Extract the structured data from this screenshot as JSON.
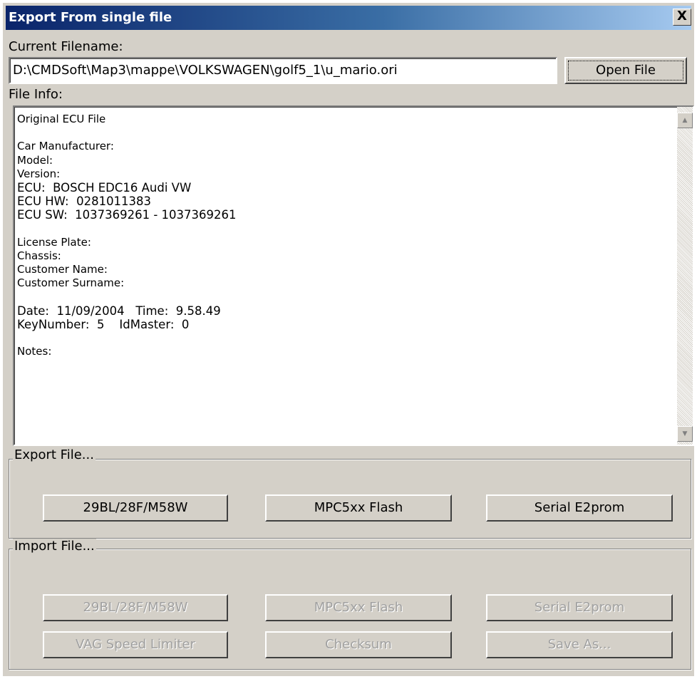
{
  "window": {
    "title": "Export From single file",
    "close_glyph": "X"
  },
  "current_filename": {
    "label": "Current Filename:",
    "value": "D:\\CMDSoft\\Map3\\mappe\\VOLKSWAGEN\\golf5_1\\u_mario.ori",
    "open_button": "Open File"
  },
  "file_info": {
    "label": "File Info:",
    "lines": [
      "Original ECU File",
      "",
      "Car Manufacturer:",
      "Model:",
      "Version:",
      "ECU:  BOSCH EDC16 Audi VW",
      "ECU HW:  0281011383",
      "ECU SW:  1037369261 - 1037369261",
      "",
      "License Plate:",
      "Chassis:",
      "Customer Name:",
      "Customer Surname:",
      "",
      "Date:  11/09/2004   Time:  9.58.49",
      "KeyNumber:  5    IdMaster:  0",
      "",
      "Notes:"
    ],
    "scroll_up_icon": "arrow-up-icon",
    "scroll_down_icon": "arrow-down-icon"
  },
  "export_group": {
    "title": "Export File...",
    "buttons": [
      "29BL/28F/M58W",
      "MPC5xx Flash",
      "Serial E2prom"
    ]
  },
  "import_group": {
    "title": "Import File...",
    "buttons_row1": [
      "29BL/28F/M58W",
      "MPC5xx Flash",
      "Serial E2prom"
    ],
    "buttons_row2": [
      "VAG Speed Limiter",
      "Checksum",
      "Save As..."
    ]
  },
  "colors": {
    "face": "#d4d0c8",
    "title_start": "#0a246a",
    "title_end": "#a6caf0",
    "disabled_text": "#a0a0a0"
  }
}
